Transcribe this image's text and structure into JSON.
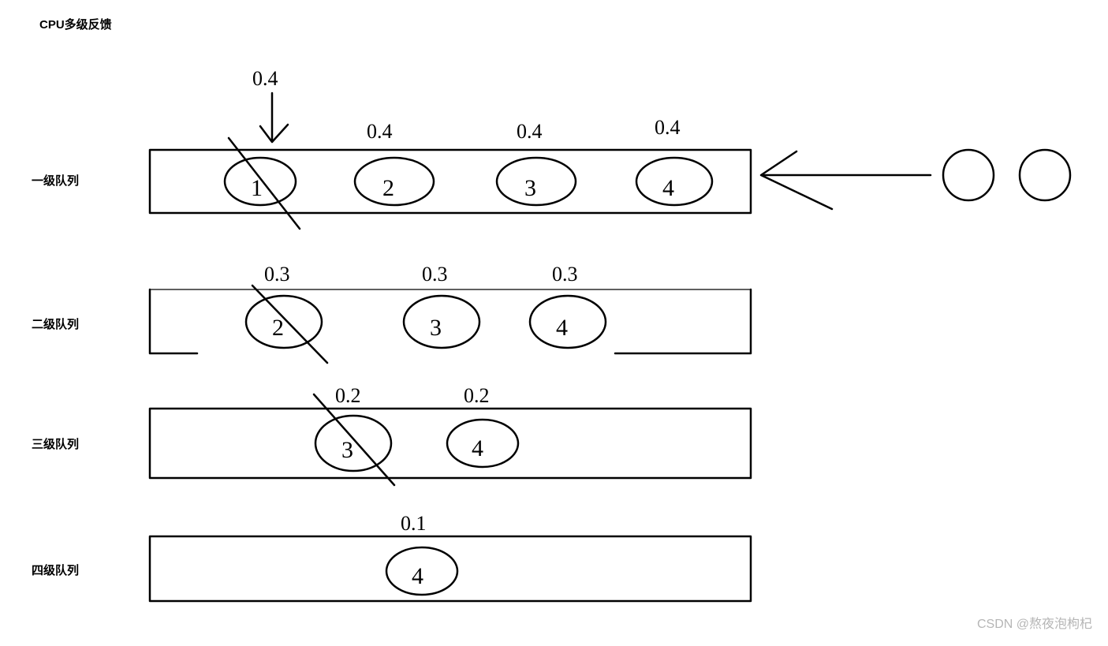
{
  "title": "CPU多级反馈",
  "watermark": "CSDN @熬夜泡枸杞",
  "queues": [
    {
      "label": "一级队列",
      "top_annotation": "0.4",
      "items": [
        "1",
        "2",
        "3",
        "4"
      ],
      "item_annotations": [
        "0.4",
        "0.4",
        "0.4",
        "0.4"
      ],
      "crossed_item_index": 0,
      "incoming_arrow": true,
      "incoming_processes": 2
    },
    {
      "label": "二级队列",
      "items": [
        "2",
        "3",
        "4"
      ],
      "item_annotations": [
        "0.3",
        "0.3",
        "0.3"
      ],
      "crossed_item_index": 0
    },
    {
      "label": "三级队列",
      "items": [
        "3",
        "4"
      ],
      "item_annotations": [
        "0.2",
        "0.2"
      ],
      "crossed_item_index": 0
    },
    {
      "label": "四级队列",
      "items": [
        "4"
      ],
      "item_annotations": [
        "0.1"
      ]
    }
  ]
}
